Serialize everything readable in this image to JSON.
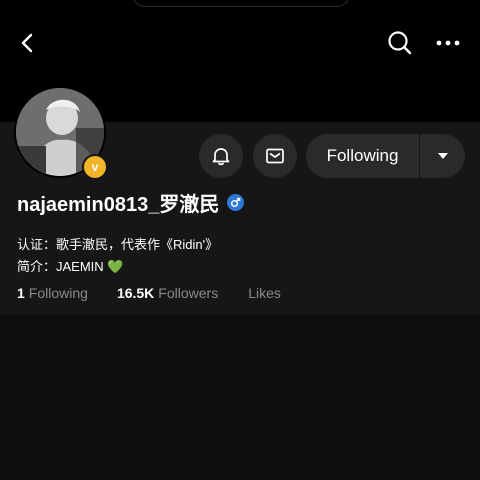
{
  "nav": {
    "back_icon": "chevron-left-icon",
    "search_icon": "search-icon",
    "more_icon": "more-horizontal-icon"
  },
  "profile": {
    "avatar_badge": "v",
    "username": "najaemin0813_罗澈民",
    "gender_icon": "male-icon",
    "certification": "认证：歌手澈民，代表作《Ridin'》",
    "bio": "简介：JAEMIN 💚",
    "follow_label": "Following"
  },
  "stats": {
    "following_count": "1",
    "following_label": "Following",
    "followers_count": "16.5K",
    "followers_label": "Followers",
    "likes_count": "",
    "likes_label": "Likes"
  },
  "colors": {
    "background": "#141414",
    "header": "#000000",
    "button": "#2a2a2a",
    "badge": "#f1b52a",
    "gender": "#2f78d6",
    "muted_text": "#8a8a8a"
  }
}
